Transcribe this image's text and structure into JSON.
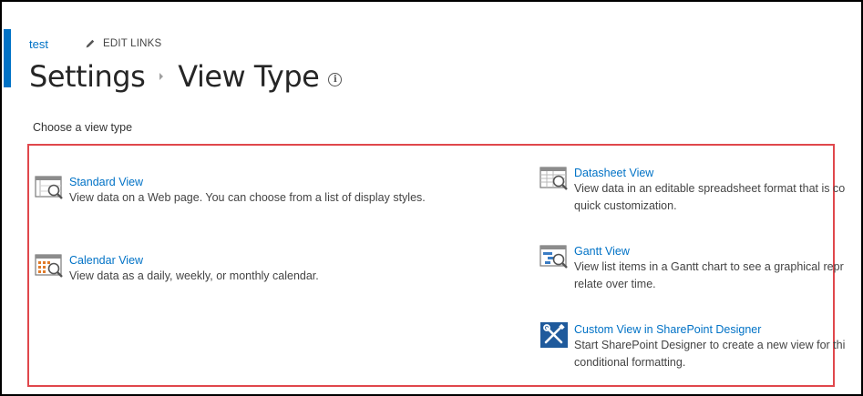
{
  "nav": {
    "site_link": "test",
    "edit_links": "EDIT LINKS"
  },
  "header": {
    "breadcrumb_parent": "Settings",
    "title": "View Type"
  },
  "main": {
    "choose_label": "Choose a view type",
    "options": [
      {
        "name": "Standard View",
        "desc_lines": [
          "View data on a Web page. You can choose from a list of display styles."
        ],
        "icon": "standard-view-icon"
      },
      {
        "name": "Calendar View",
        "desc_lines": [
          "View data as a daily, weekly, or monthly calendar."
        ],
        "icon": "calendar-view-icon"
      },
      {
        "name": "Datasheet View",
        "desc_lines": [
          "View data in an editable spreadsheet format that is co",
          "quick customization."
        ],
        "icon": "datasheet-view-icon"
      },
      {
        "name": "Gantt View",
        "desc_lines": [
          "View list items in a Gantt chart to see a graphical repr",
          "relate over time."
        ],
        "icon": "gantt-view-icon"
      },
      {
        "name": "Custom View in SharePoint Designer",
        "desc_lines": [
          "Start SharePoint Designer to create a new view for thi",
          "conditional formatting."
        ],
        "icon": "sharepoint-designer-icon"
      }
    ]
  },
  "colors": {
    "accent": "#0072c6",
    "highlight_border": "#e0474c",
    "title_text": "#262626"
  }
}
